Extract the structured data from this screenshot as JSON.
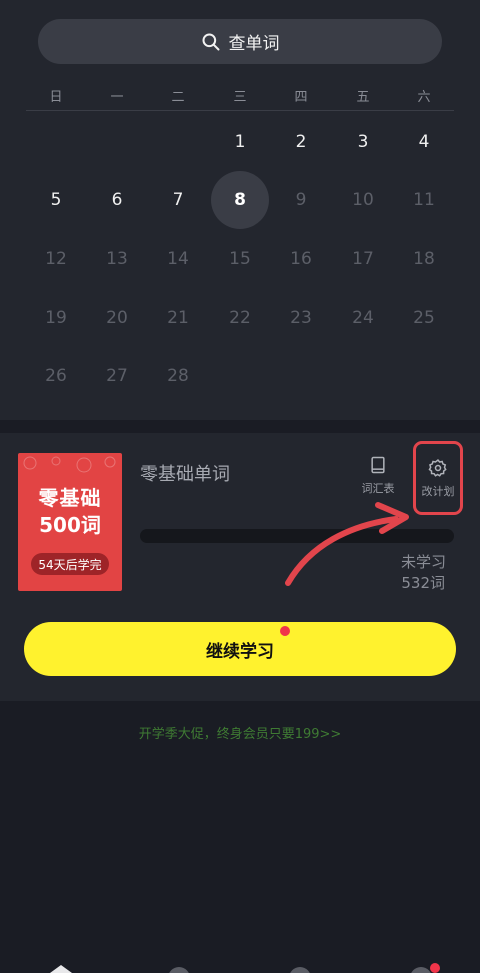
{
  "search": {
    "label": "查单词"
  },
  "calendar": {
    "weekdays": [
      "日",
      "一",
      "二",
      "三",
      "四",
      "五",
      "六"
    ],
    "days": [
      {
        "d": "1",
        "state": "active"
      },
      {
        "d": "2",
        "state": "active"
      },
      {
        "d": "3",
        "state": "active"
      },
      {
        "d": "4",
        "state": "active"
      },
      {
        "d": "5",
        "state": "active"
      },
      {
        "d": "6",
        "state": "active"
      },
      {
        "d": "7",
        "state": "active"
      },
      {
        "d": "8",
        "state": "today"
      },
      {
        "d": "9",
        "state": "future"
      },
      {
        "d": "10",
        "state": "future"
      },
      {
        "d": "11",
        "state": "future"
      },
      {
        "d": "12",
        "state": "future"
      },
      {
        "d": "13",
        "state": "future"
      },
      {
        "d": "14",
        "state": "future"
      },
      {
        "d": "15",
        "state": "future"
      },
      {
        "d": "16",
        "state": "future"
      },
      {
        "d": "17",
        "state": "future"
      },
      {
        "d": "18",
        "state": "future"
      },
      {
        "d": "19",
        "state": "future"
      },
      {
        "d": "20",
        "state": "future"
      },
      {
        "d": "21",
        "state": "future"
      },
      {
        "d": "22",
        "state": "future"
      },
      {
        "d": "23",
        "state": "future"
      },
      {
        "d": "24",
        "state": "future"
      },
      {
        "d": "25",
        "state": "future"
      },
      {
        "d": "26",
        "state": "future"
      },
      {
        "d": "27",
        "state": "future"
      },
      {
        "d": "28",
        "state": "future"
      }
    ]
  },
  "plan": {
    "cover_title": "零基础",
    "cover_count": "500词",
    "cover_badge": "54天后学完",
    "name": "零基础单词",
    "vocab_label": "词汇表",
    "change_label": "改计划",
    "progress": 0,
    "stat_label": "未学习",
    "stat_value": "532词",
    "continue_label": "继续学习"
  },
  "promo": "开学季大促，终身会员只要199>>",
  "colors": {
    "accent": "#fff22e",
    "badge": "#f0354a",
    "highlight": "#e2454c",
    "cover": "#e24444"
  },
  "icons": [
    "search-icon",
    "book-icon",
    "gear-icon",
    "home-icon"
  ]
}
